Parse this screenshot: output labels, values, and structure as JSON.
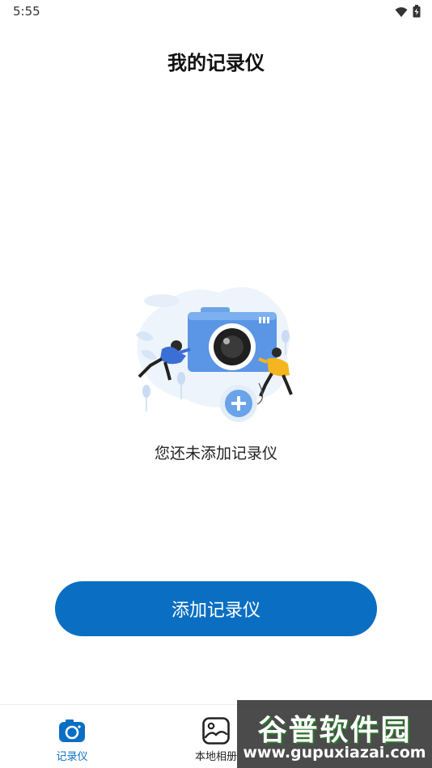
{
  "status_bar": {
    "time": "5:55",
    "wifi_icon": "wifi-icon",
    "battery_icon": "battery-charging-icon"
  },
  "header": {
    "title": "我的记录仪"
  },
  "empty_state": {
    "illustration": "camera-illustration",
    "message": "您还未添加记录仪"
  },
  "actions": {
    "add_label": "添加记录仪"
  },
  "bottom_nav": {
    "items": [
      {
        "label": "记录仪",
        "icon": "camera-icon",
        "active": true
      },
      {
        "label": "本地相册",
        "icon": "gallery-icon",
        "active": false
      }
    ]
  },
  "colors": {
    "primary": "#0a6fc2",
    "background": "#ffffff"
  },
  "watermark": {
    "logo": "谷普软件园",
    "url": "www.gupuxiazai.com"
  }
}
